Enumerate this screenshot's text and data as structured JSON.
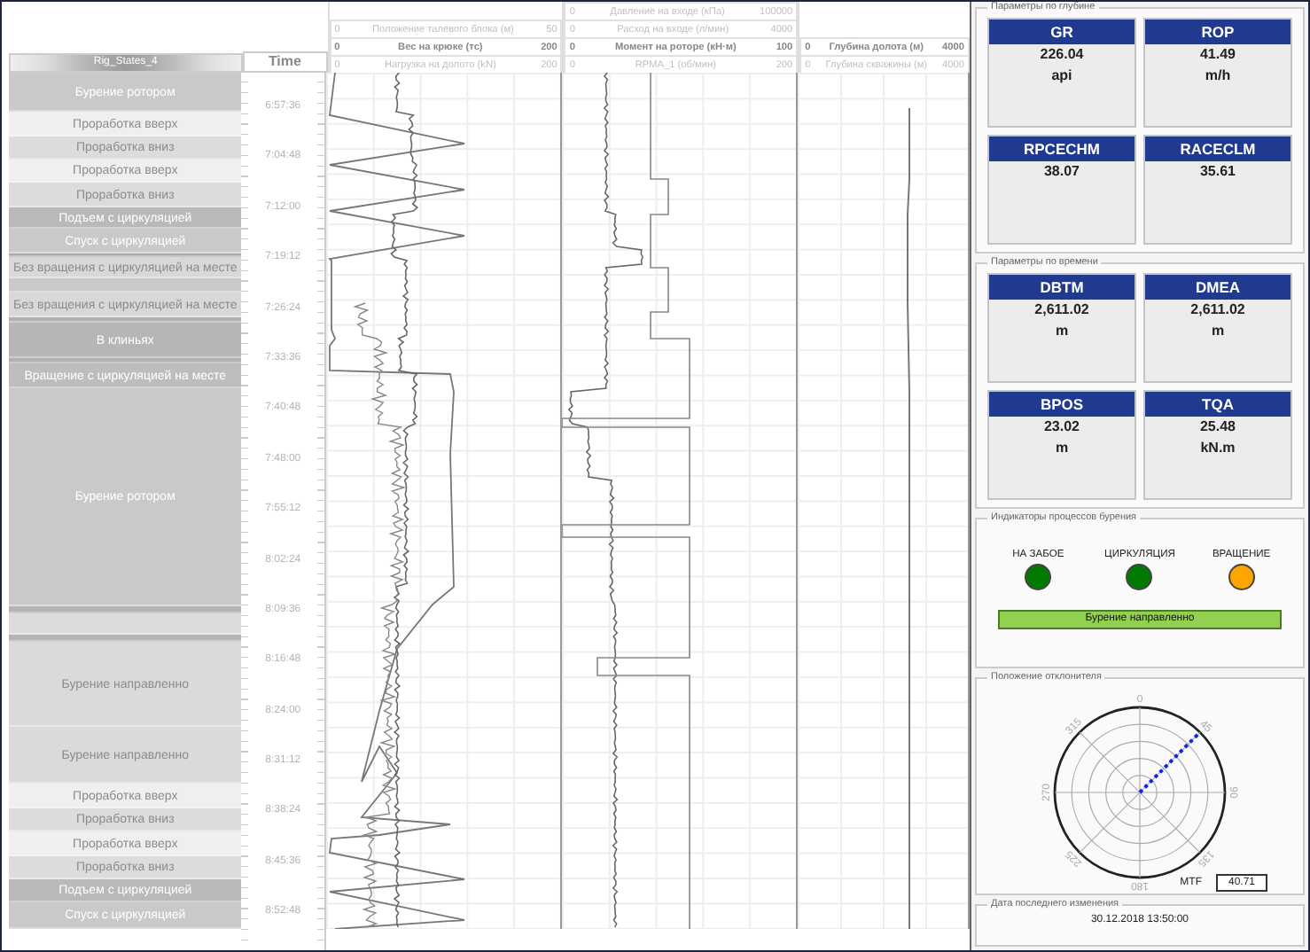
{
  "header": {
    "state_track": {
      "title": "Rig_States_4"
    },
    "time_track": {
      "title": "Time"
    },
    "tracks": [
      {
        "curves": [
          {
            "min": "0",
            "name": "Положение талевого блока (м)",
            "max": "50",
            "highlighted": false
          },
          {
            "min": "0",
            "name": "Вес на крюке (тс)",
            "max": "200",
            "highlighted": true
          },
          {
            "min": "0",
            "name": "Нагрузка на долото (kN)",
            "max": "200",
            "highlighted": false
          }
        ]
      },
      {
        "curves": [
          {
            "min": "0",
            "name": "Давление на входе (кПа)",
            "max": "100000",
            "highlighted": false
          },
          {
            "min": "0",
            "name": "Расход на входе (л/мин)",
            "max": "4000",
            "highlighted": false
          },
          {
            "min": "0",
            "name": "Момент на роторе (кН·м)",
            "max": "100",
            "highlighted": true
          },
          {
            "min": "0",
            "name": "RPMA_1 (об/мин)",
            "max": "200",
            "highlighted": false
          }
        ]
      },
      {
        "curves": [
          {
            "min": "0",
            "name": "Глубина долота (м)",
            "max": "4000",
            "highlighted": true
          },
          {
            "min": "0",
            "name": "Глубина скважины (м)",
            "max": "4000",
            "highlighted": false
          }
        ]
      }
    ]
  },
  "states": [
    {
      "label": "Бурение ротором",
      "color": "#c9c9c9"
    },
    {
      "label": "Проработка вверх",
      "color": "#efefef"
    },
    {
      "label": "Проработка вниз",
      "color": "#dcdcdc"
    },
    {
      "label": "Проработка вверх",
      "color": "#efefef"
    },
    {
      "label": "Проработка вниз",
      "color": "#dcdcdc"
    },
    {
      "label": "Подъем с циркуляцией",
      "color": "#b9b9b9"
    },
    {
      "label": "Спуск с циркуляцией",
      "color": "#c9c9c9"
    },
    {
      "color": "#a8a8a8"
    },
    {
      "label": "Без вращения с циркуляцией на месте",
      "color": "#d8d8d8"
    },
    {
      "color": "#c9c9c9"
    },
    {
      "label": "Без вращения с циркуляцией на месте",
      "color": "#d8d8d8"
    },
    {
      "color": "#b0b0b0"
    },
    {
      "label": "В клиньях",
      "color": "#b6b6b6"
    },
    {
      "color": "#b0b0b0"
    },
    {
      "label": "Вращение с циркуляцией на месте",
      "color": "#bdbdbd"
    },
    {
      "label": "Бурение ротором",
      "color": "#c9c9c9"
    },
    {
      "color": "#b4b4b4"
    },
    {
      "color": "#dcdcdc"
    },
    {
      "color": "#b4b4b4"
    },
    {
      "label": "Бурение направленно",
      "color": "#dadada"
    },
    {
      "label": "Бурение направленно",
      "color": "#dadada"
    },
    {
      "label": "Проработка вверх",
      "color": "#efefef"
    },
    {
      "label": "Проработка вниз",
      "color": "#dcdcdc"
    },
    {
      "label": "Проработка вверх",
      "color": "#efefef"
    },
    {
      "label": "Проработка вниз",
      "color": "#dcdcdc"
    },
    {
      "label": "Подъем с циркуляцией",
      "color": "#b9b9b9"
    },
    {
      "label": "Спуск с циркуляцией",
      "color": "#c9c9c9"
    }
  ],
  "time_ticks": [
    "6:57:36",
    "7:04:48",
    "7:12:00",
    "7:19:12",
    "7:26:24",
    "7:33:36",
    "7:40:48",
    "7:48:00",
    "7:55:12",
    "8:02:24",
    "8:09:36",
    "8:16:48",
    "8:24:00",
    "8:31:12",
    "8:38:24",
    "8:45:36",
    "8:52:48"
  ],
  "depth_params": {
    "title": "Параметры по глубине",
    "cards": [
      {
        "name": "GR",
        "value": "226.04",
        "unit": "api"
      },
      {
        "name": "ROP",
        "value": "41.49",
        "unit": "m/h"
      },
      {
        "name": "RPCECHM",
        "value": "38.07"
      },
      {
        "name": "RACECLM",
        "value": "35.61"
      }
    ]
  },
  "time_params": {
    "title": "Параметры по времени",
    "cards": [
      {
        "name": "DBTM",
        "value": "2,611.02",
        "unit": "m"
      },
      {
        "name": "DMEA",
        "value": "2,611.02",
        "unit": "m"
      },
      {
        "name": "BPOS",
        "value": "23.02",
        "unit": "m"
      },
      {
        "name": "TQA",
        "value": "25.48",
        "unit": "kN.m"
      }
    ]
  },
  "indicators": {
    "title": "Индикаторы процессов бурения",
    "items": [
      {
        "label": "НА ЗАБОЕ",
        "color": "#007a00"
      },
      {
        "label": "ЦИРКУЛЯЦИЯ",
        "color": "#007a00"
      },
      {
        "label": "ВРАЩЕНИЕ",
        "color": "#ffa500"
      }
    ],
    "status": "Бурение направленно"
  },
  "toolface": {
    "title": "Положение отклонителя",
    "angles": [
      "0",
      "45",
      "90",
      "135",
      "180",
      "225",
      "270",
      "315"
    ],
    "mtf_label": "MTF",
    "mtf_value": "40.71"
  },
  "last_change": {
    "title": "Дата последнего изменения",
    "value": "30.12.2018 13:50:00"
  }
}
